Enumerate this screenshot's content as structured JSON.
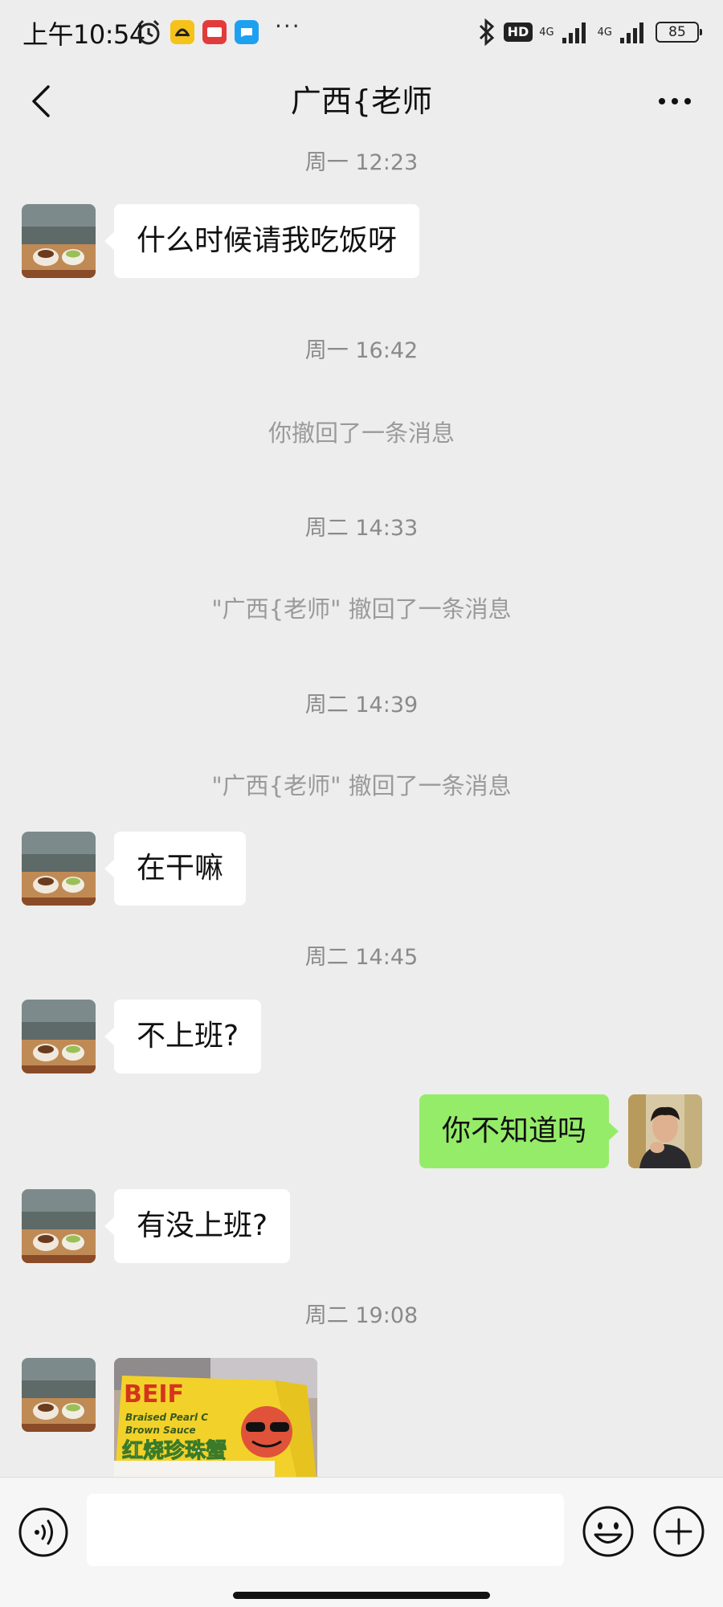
{
  "status_bar": {
    "time": "上午10:54",
    "more_dots": "···",
    "hd_badge": "HD",
    "network_1": "4G",
    "network_2": "4G",
    "battery": "85"
  },
  "nav": {
    "title": "广西{老师"
  },
  "messages": {
    "ts1": "周一 12:23",
    "m1": "什么时候请我吃饭呀",
    "ts2": "周一 16:42",
    "sys1": "你撤回了一条消息",
    "ts3": "周二 14:33",
    "sys2": "\"广西{老师\" 撤回了一条消息",
    "ts4": "周二 14:39",
    "sys3": "\"广西{老师\" 撤回了一条消息",
    "m2": "在干嘛",
    "ts5": "周二 14:45",
    "m3": "不上班?",
    "m4_out": "你不知道吗",
    "m5": "有没上班?",
    "ts6": "周二 19:08",
    "image": {
      "brand": "BEIF",
      "line1": "Braised Pearl C",
      "line2": "Brown Sauce",
      "cn_text": "红烧珍珠蟹"
    }
  },
  "input": {
    "placeholder": ""
  },
  "colors": {
    "background": "#ededed",
    "outgoing_bubble": "#95ec69",
    "incoming_bubble": "#ffffff",
    "timestamp_text": "#8a8a8a"
  },
  "icons": [
    "back-icon",
    "more-icon",
    "voice-icon",
    "emoji-icon",
    "plus-icon",
    "bluetooth-icon",
    "alarm-icon"
  ]
}
